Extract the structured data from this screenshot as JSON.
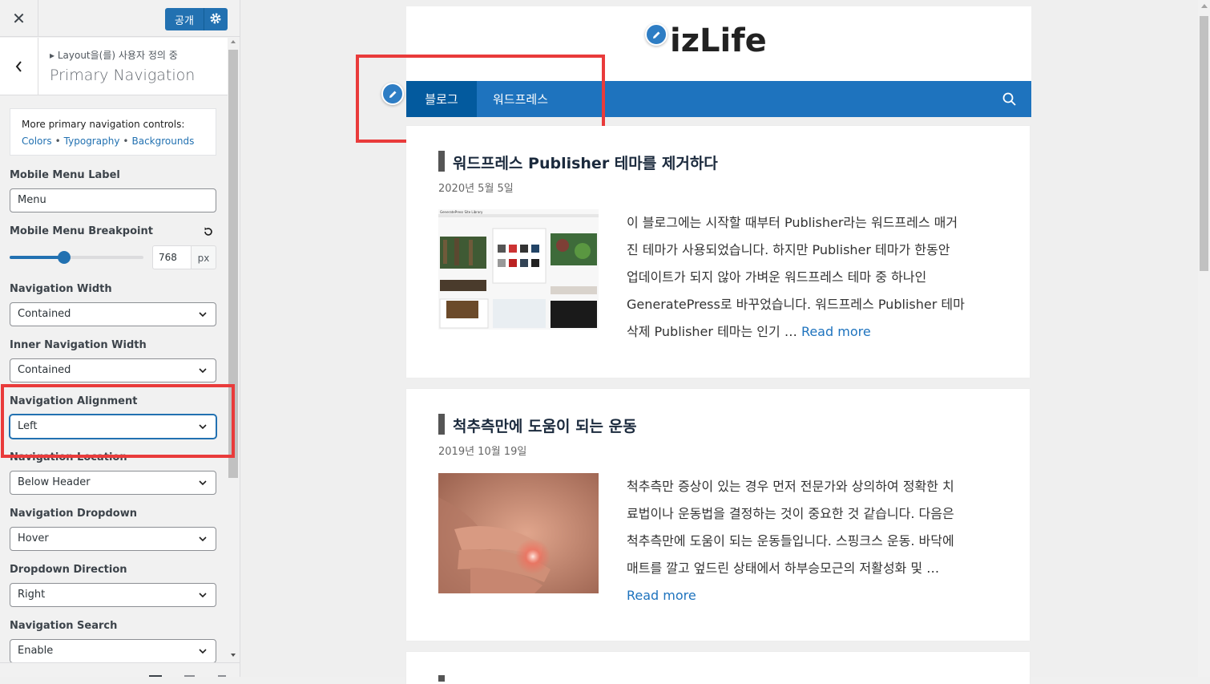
{
  "topbar": {
    "close_icon": "close-icon",
    "publish_label": "공개",
    "publish_settings_icon": "gear-icon"
  },
  "section": {
    "breadcrumb": "▸ Layout을(를) 사용자 정의 중",
    "title": "Primary Navigation"
  },
  "notice": {
    "text": "More primary navigation controls:",
    "links": [
      "Colors",
      "Typography",
      "Backgrounds"
    ]
  },
  "controls": {
    "mobile_menu_label": {
      "label": "Mobile Menu Label",
      "value": "Menu"
    },
    "mobile_menu_breakpoint": {
      "label": "Mobile Menu Breakpoint",
      "value": "768",
      "unit": "px",
      "slider_fraction": 0.41
    },
    "navigation_width": {
      "label": "Navigation Width",
      "value": "Contained"
    },
    "inner_navigation_width": {
      "label": "Inner Navigation Width",
      "value": "Contained"
    },
    "navigation_alignment": {
      "label": "Navigation Alignment",
      "value": "Left"
    },
    "navigation_location": {
      "label": "Navigation Location",
      "value": "Below Header"
    },
    "navigation_dropdown": {
      "label": "Navigation Dropdown",
      "value": "Hover"
    },
    "dropdown_direction": {
      "label": "Dropdown Direction",
      "value": "Right"
    },
    "navigation_search": {
      "label": "Navigation Search",
      "value": "Enable"
    }
  },
  "preview": {
    "logo": "izLife",
    "nav": {
      "items": [
        "블로그",
        "워드프레스"
      ],
      "active_index": 0,
      "search_icon": "search-icon"
    },
    "posts": [
      {
        "title": "워드프레스 Publisher 테마를 제거하다",
        "date": "2020년 5월 5일",
        "excerpt_lines": [
          "이 블로그에는 시작할 때부터 Publisher라는 워드프레스 매거",
          "진 테마가 사용되었습니다. 하지만 Publisher 테마가 한동안",
          "업데이트가 되지 않아 가벼운 워드프레스 테마 중 하나인",
          "GeneratePress로 바꾸었습니다. 워드프레스 Publisher 테마",
          "삭제 Publisher 테마는 인기 … "
        ],
        "read_more": "Read more",
        "thumbnail_caption": "GeneratePress Site Library"
      },
      {
        "title": "척추측만에 도움이 되는 운동",
        "date": "2019년 10월 19일",
        "excerpt_lines": [
          "척추측만 증상이 있는 경우 먼저 전문가와 상의하여 정확한 치",
          "료법이나 운동법을 결정하는 것이 중요한 것 같습니다. 다음은",
          "척추측만에 도움이 되는 운동들입니다. 스핑크스 운동. 바닥에",
          "매트를 깔고 엎드린 상태에서 하부승모근의 저활성화 및 …"
        ],
        "read_more": "Read more"
      }
    ]
  },
  "colors": {
    "accent": "#2271b1",
    "nav_bg": "#1e73be",
    "nav_active": "#035a9e",
    "highlight": "#e93b3b"
  }
}
